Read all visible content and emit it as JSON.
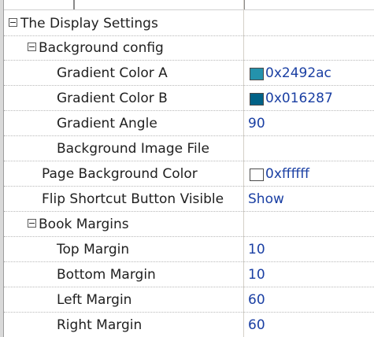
{
  "rows": [
    {
      "label": "The Display Settings",
      "value": ""
    },
    {
      "label": "Background config",
      "value": ""
    },
    {
      "label": "Gradient Color A",
      "value": "0x2492ac",
      "color": "#2492ac"
    },
    {
      "label": "Gradient Color B",
      "value": "0x016287",
      "color": "#016287"
    },
    {
      "label": "Gradient Angle",
      "value": "90"
    },
    {
      "label": "Background Image File",
      "value": ""
    },
    {
      "label": "Page Background Color",
      "value": "0xffffff",
      "color": "#ffffff"
    },
    {
      "label": "Flip Shortcut Button Visible",
      "value": "Show"
    },
    {
      "label": "Book Margins",
      "value": ""
    },
    {
      "label": "Top Margin",
      "value": "10"
    },
    {
      "label": "Bottom Margin",
      "value": "10"
    },
    {
      "label": "Left Margin",
      "value": "60"
    },
    {
      "label": "Right Margin",
      "value": "60"
    }
  ],
  "icons": {
    "group_toggle": "collapse-minus-icon",
    "color_swatch": "color-swatch-icon"
  },
  "colors": {
    "value_text": "#1a3fa3",
    "grid_line": "#b9b9b9"
  }
}
